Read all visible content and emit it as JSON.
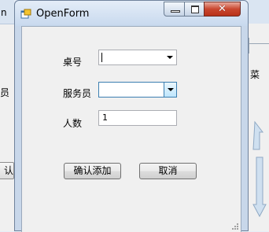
{
  "background": {
    "left_top_fragment": "n",
    "left_label_fragment": "员",
    "left_button_fragment": "认添",
    "right_label_fragment": "菜"
  },
  "window": {
    "title": "OpenForm",
    "icon": "form-app-icon",
    "controls": {
      "minimize": "minimize",
      "maximize": "maximize",
      "close": "✕"
    }
  },
  "form": {
    "table_label": "桌号",
    "table_value": "",
    "waiter_label": "服务员",
    "waiter_value": "",
    "people_label": "人数",
    "people_value": "1",
    "confirm_label": "确认添加",
    "cancel_label": "取消"
  }
}
